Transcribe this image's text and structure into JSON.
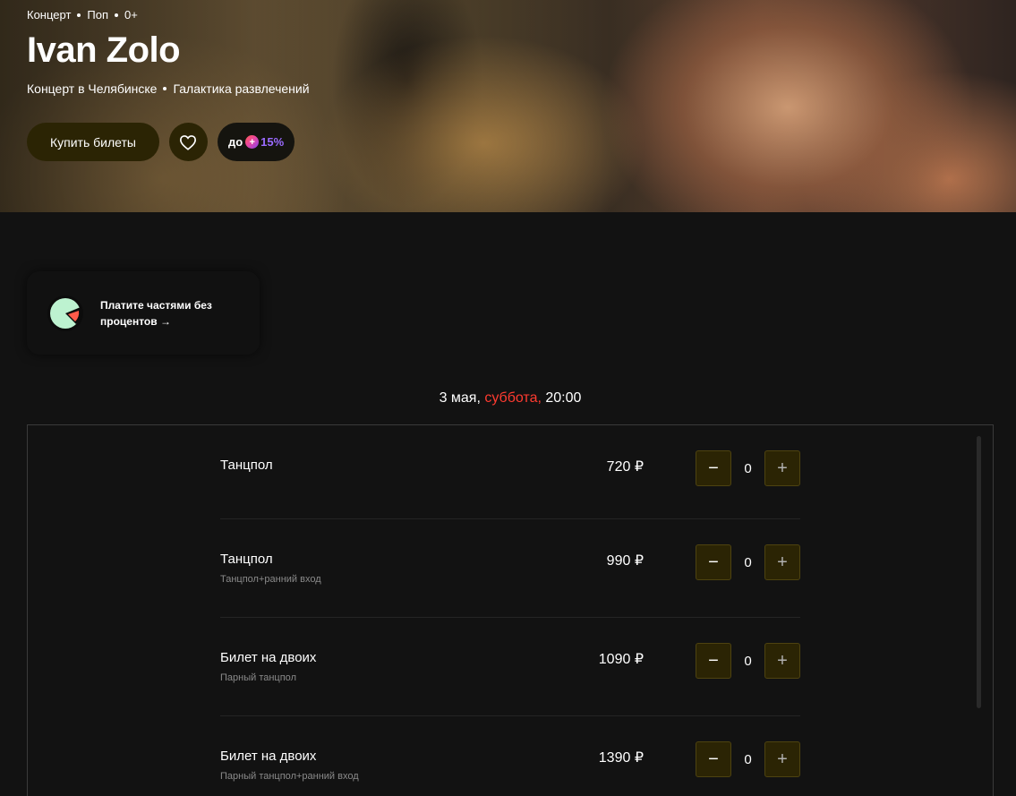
{
  "hero": {
    "tags": [
      "Концерт",
      "Поп",
      "0+"
    ],
    "title": "Ivan Zolo",
    "subtitle": [
      "Концерт в Челябинске",
      "Галактика развлечений"
    ],
    "buy_label": "Купить билеты",
    "plus_prefix": "до",
    "plus_percent": "15%"
  },
  "promo": {
    "text": "Платите частями без процентов →"
  },
  "date": {
    "day": "3 мая,",
    "weekday": "суббота,",
    "time": "20:00"
  },
  "tickets": [
    {
      "name": "Танцпол",
      "sub": "",
      "price": "720 ₽",
      "qty": "0"
    },
    {
      "name": "Танцпол",
      "sub": "Танцпол+ранний вход",
      "price": "990 ₽",
      "qty": "0"
    },
    {
      "name": "Билет на двоих",
      "sub": "Парный танцпол",
      "price": "1090 ₽",
      "qty": "0"
    },
    {
      "name": "Билет на двоих",
      "sub": "Парный танцпол+ранний вход",
      "price": "1390 ₽",
      "qty": "0"
    }
  ],
  "stepper": {
    "minus": "−",
    "plus": "+"
  },
  "colors": {
    "accent_dark": "#2b2404",
    "weekday": "#ff3b30",
    "plus_purple": "#9b6bff"
  }
}
